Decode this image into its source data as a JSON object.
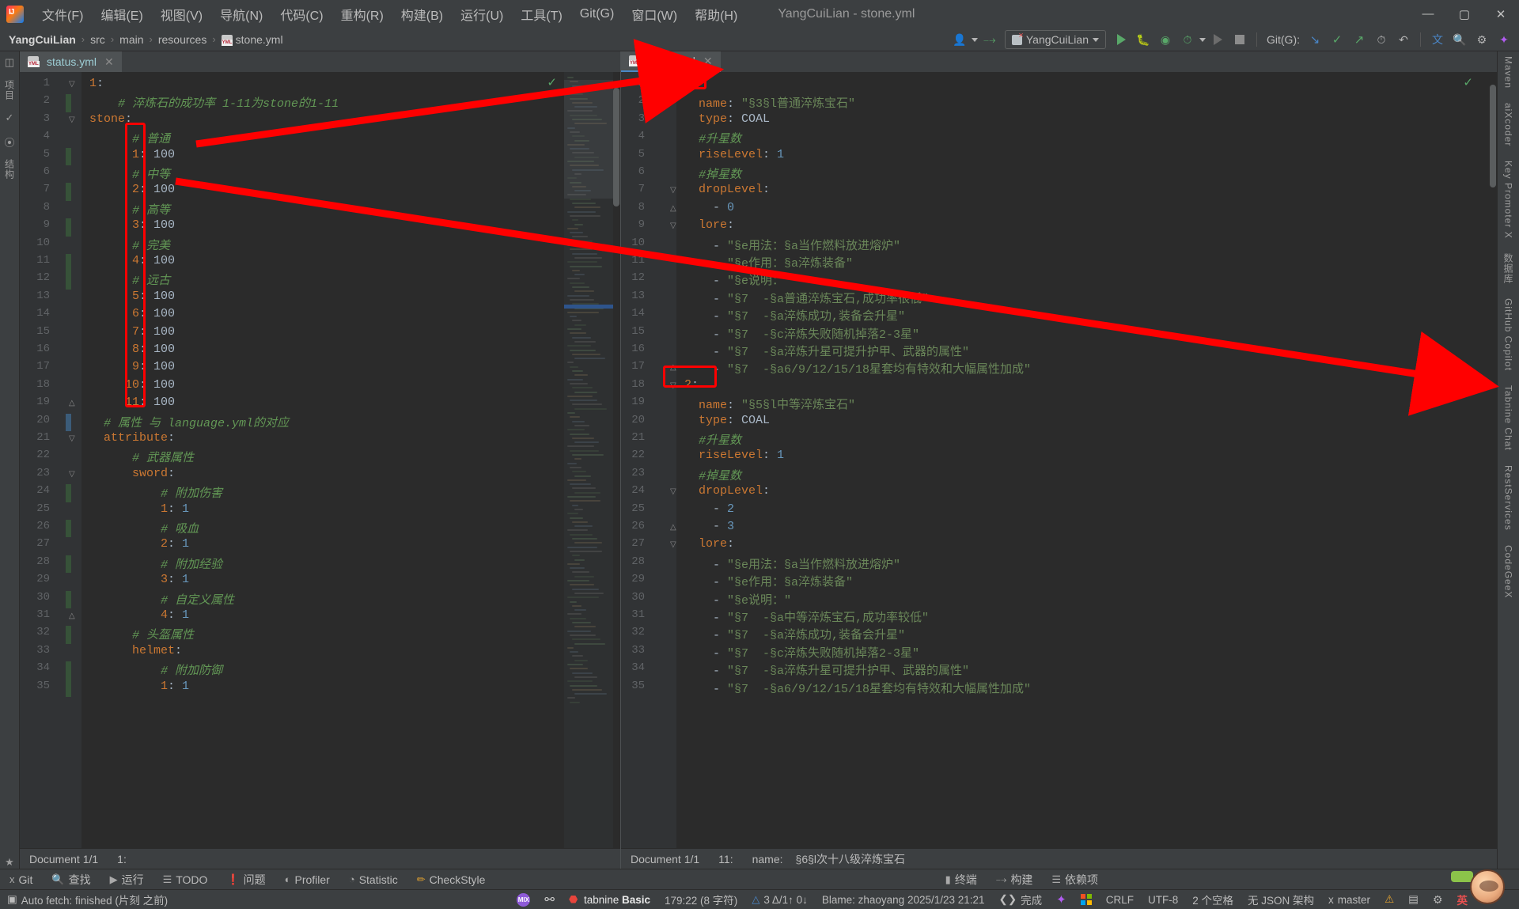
{
  "window": {
    "title": "YangCuiLian - stone.yml",
    "controls": {
      "minimize": "—",
      "maximize": "▢",
      "close": "✕"
    }
  },
  "menubar": {
    "items": [
      {
        "label": "文件(F)"
      },
      {
        "label": "编辑(E)"
      },
      {
        "label": "视图(V)"
      },
      {
        "label": "导航(N)"
      },
      {
        "label": "代码(C)"
      },
      {
        "label": "重构(R)"
      },
      {
        "label": "构建(B)"
      },
      {
        "label": "运行(U)"
      },
      {
        "label": "工具(T)"
      },
      {
        "label": "Git(G)"
      },
      {
        "label": "窗口(W)"
      },
      {
        "label": "帮助(H)"
      }
    ]
  },
  "navbar": {
    "breadcrumbs": [
      "YangCuiLian",
      "src",
      "main",
      "resources",
      "stone.yml"
    ],
    "separator": "›",
    "run_config": "YangCuiLian",
    "git_label": "Git(G):"
  },
  "panes": {
    "left": {
      "tab": "status.yml",
      "lines": [
        {
          "n": 1,
          "text": "1:",
          "cls": "k"
        },
        {
          "n": 2,
          "text": "    # 淬炼石的成功率 1-11为stone的1-11",
          "cls": "c"
        },
        {
          "n": 3,
          "text": "stone:",
          "cls": "k"
        },
        {
          "n": 4,
          "text": "      # 普通",
          "cls": "c"
        },
        {
          "n": 5,
          "text": "      1: 100",
          "cls": "kv"
        },
        {
          "n": 6,
          "text": "      # 中等",
          "cls": "c"
        },
        {
          "n": 7,
          "text": "      2: 100",
          "cls": "kv"
        },
        {
          "n": 8,
          "text": "      # 高等",
          "cls": "c"
        },
        {
          "n": 9,
          "text": "      3: 100",
          "cls": "kv"
        },
        {
          "n": 10,
          "text": "      # 完美",
          "cls": "c"
        },
        {
          "n": 11,
          "text": "      4: 100",
          "cls": "kv"
        },
        {
          "n": 12,
          "text": "      # 远古",
          "cls": "c"
        },
        {
          "n": 13,
          "text": "      5: 100",
          "cls": "kv"
        },
        {
          "n": 14,
          "text": "      6: 100",
          "cls": "kv"
        },
        {
          "n": 15,
          "text": "      7: 100",
          "cls": "kv"
        },
        {
          "n": 16,
          "text": "      8: 100",
          "cls": "kv"
        },
        {
          "n": 17,
          "text": "      9: 100",
          "cls": "kv"
        },
        {
          "n": 18,
          "text": "     10: 100",
          "cls": "kv"
        },
        {
          "n": 19,
          "text": "     11: 100",
          "cls": "kv"
        },
        {
          "n": 20,
          "text": "  # 属性 与 language.yml的对应",
          "cls": "c"
        },
        {
          "n": 21,
          "text": "  attribute:",
          "cls": "k"
        },
        {
          "n": 22,
          "text": "      # 武器属性",
          "cls": "c"
        },
        {
          "n": 23,
          "text": "      sword:",
          "cls": "k"
        },
        {
          "n": 24,
          "text": "          # 附加伤害",
          "cls": "c"
        },
        {
          "n": 25,
          "text": "          1: 1",
          "cls": "kv"
        },
        {
          "n": 26,
          "text": "          # 吸血",
          "cls": "c"
        },
        {
          "n": 27,
          "text": "          2: 1",
          "cls": "kv"
        },
        {
          "n": 28,
          "text": "          # 附加经验",
          "cls": "c"
        },
        {
          "n": 29,
          "text": "          3: 1",
          "cls": "kv"
        },
        {
          "n": 30,
          "text": "          # 自定义属性",
          "cls": "c"
        },
        {
          "n": 31,
          "text": "          4: 1",
          "cls": "kv"
        },
        {
          "n": 32,
          "text": "      # 头盔属性",
          "cls": "c"
        },
        {
          "n": 33,
          "text": "      helmet:",
          "cls": "k"
        },
        {
          "n": 34,
          "text": "          # 附加防御",
          "cls": "c"
        },
        {
          "n": 35,
          "text": "          1: 1",
          "cls": "kv"
        }
      ],
      "docbar": {
        "document": "Document 1/1",
        "position": "1:"
      }
    },
    "right": {
      "tab": "stone.yml",
      "lines": [
        {
          "n": 1,
          "text": "1:",
          "cls": "k"
        },
        {
          "n": 2,
          "text": "  name: \"§3§l普通淬炼宝石\"",
          "cls": "kv"
        },
        {
          "n": 3,
          "text": "  type: COAL",
          "cls": "kv"
        },
        {
          "n": 4,
          "text": "  #升星数",
          "cls": "c"
        },
        {
          "n": 5,
          "text": "  riseLevel: 1",
          "cls": "kv"
        },
        {
          "n": 6,
          "text": "  #掉星数",
          "cls": "c"
        },
        {
          "n": 7,
          "text": "  dropLevel:",
          "cls": "k"
        },
        {
          "n": 8,
          "text": "    - 0",
          "cls": "num"
        },
        {
          "n": 9,
          "text": "  lore:",
          "cls": "k"
        },
        {
          "n": 10,
          "text": "    - \"§e用法：§a当作燃料放进熔炉\"",
          "cls": "s"
        },
        {
          "n": 11,
          "text": "    - \"§e作用：§a淬炼装备\"",
          "cls": "s"
        },
        {
          "n": 12,
          "text": "    - \"§e说明：\"",
          "cls": "s"
        },
        {
          "n": 13,
          "text": "    - \"§7  -§a普通淬炼宝石,成功率很低\"",
          "cls": "s"
        },
        {
          "n": 14,
          "text": "    - \"§7  -§a淬炼成功,装备会升星\"",
          "cls": "s"
        },
        {
          "n": 15,
          "text": "    - \"§7  -§c淬炼失败随机掉落2-3星\"",
          "cls": "s"
        },
        {
          "n": 16,
          "text": "    - \"§7  -§a淬炼升星可提升护甲、武器的属性\"",
          "cls": "s"
        },
        {
          "n": 17,
          "text": "    - \"§7  -§a6/9/12/15/18星套均有特效和大幅属性加成\"",
          "cls": "s"
        },
        {
          "n": 18,
          "text": "2:",
          "cls": "k"
        },
        {
          "n": 19,
          "text": "  name: \"§5§l中等淬炼宝石\"",
          "cls": "kv"
        },
        {
          "n": 20,
          "text": "  type: COAL",
          "cls": "kv"
        },
        {
          "n": 21,
          "text": "  #升星数",
          "cls": "c"
        },
        {
          "n": 22,
          "text": "  riseLevel: 1",
          "cls": "kv"
        },
        {
          "n": 23,
          "text": "  #掉星数",
          "cls": "c"
        },
        {
          "n": 24,
          "text": "  dropLevel:",
          "cls": "k"
        },
        {
          "n": 25,
          "text": "    - 2",
          "cls": "num"
        },
        {
          "n": 26,
          "text": "    - 3",
          "cls": "num"
        },
        {
          "n": 27,
          "text": "  lore:",
          "cls": "k"
        },
        {
          "n": 28,
          "text": "    - \"§e用法：§a当作燃料放进熔炉\"",
          "cls": "s"
        },
        {
          "n": 29,
          "text": "    - \"§e作用：§a淬炼装备\"",
          "cls": "s"
        },
        {
          "n": 30,
          "text": "    - \"§e说明：\"",
          "cls": "s"
        },
        {
          "n": 31,
          "text": "    - \"§7  -§a中等淬炼宝石,成功率较低\"",
          "cls": "s"
        },
        {
          "n": 32,
          "text": "    - \"§7  -§a淬炼成功,装备会升星\"",
          "cls": "s"
        },
        {
          "n": 33,
          "text": "    - \"§7  -§c淬炼失败随机掉落2-3星\"",
          "cls": "s"
        },
        {
          "n": 34,
          "text": "    - \"§7  -§a淬炼升星可提升护甲、武器的属性\"",
          "cls": "s"
        },
        {
          "n": 35,
          "text": "    - \"§7  -§a6/9/12/15/18星套均有特效和大幅属性加成\"",
          "cls": "s"
        }
      ],
      "docbar": {
        "document": "Document 1/1",
        "position": "11:",
        "crumb_key": "name:",
        "crumb_value": "§6§l次十八级淬炼宝石"
      }
    }
  },
  "annotations": {
    "boxes": [
      {
        "name": "left-key-column-box"
      },
      {
        "name": "right-line1-box"
      },
      {
        "name": "right-line18-box"
      }
    ],
    "arrows": [
      {
        "name": "arrow-to-line-1"
      },
      {
        "name": "arrow-to-line-18"
      }
    ]
  },
  "toolwindows": {
    "left": [
      {
        "label": "Git",
        "icon": "git-branch-icon"
      },
      {
        "label": "查找",
        "icon": "search-icon"
      },
      {
        "label": "运行",
        "icon": "run-icon"
      },
      {
        "label": "TODO",
        "icon": "list-icon"
      },
      {
        "label": "问题",
        "icon": "error-icon"
      },
      {
        "label": "Profiler",
        "icon": "profiler-icon"
      },
      {
        "label": "Statistic",
        "icon": "pie-icon"
      },
      {
        "label": "CheckStyle",
        "icon": "pencil-icon"
      }
    ],
    "right": [
      {
        "label": "终端",
        "icon": "terminal-icon"
      },
      {
        "label": "构建",
        "icon": "build-hammer-icon"
      },
      {
        "label": "依赖项",
        "icon": "layers-icon"
      }
    ]
  },
  "statusbar": {
    "left_message": "Auto fetch: finished (片刻 之前)",
    "caret": "179:22 (8 字符)",
    "vcs_changes": "3 Δ/1↑ 0↓",
    "blame": "Blame: zhaoyang 2025/1/23 21:21",
    "done": "完成",
    "line_sep": "CRLF",
    "encoding": "UTF-8",
    "indent": "2 个空格",
    "schema": "无 JSON 架构",
    "branch": "master",
    "ime": "英"
  },
  "rails": {
    "left": [
      "项目",
      "提交",
      "拉取请求",
      "收藏夹",
      "结构"
    ],
    "right": [
      "Maven",
      "aiXcoder",
      "Key Promoter X",
      "数据库",
      "GitHub Copilot",
      "Tabnine Chat",
      "RestServices",
      "CodeGeeX"
    ]
  },
  "colors": {
    "accent_red": "#ff0000",
    "green_run": "#59a869",
    "blue_tab": "#4a88c7",
    "editor_bg": "#2b2b2b",
    "chrome_bg": "#3c3f41"
  }
}
